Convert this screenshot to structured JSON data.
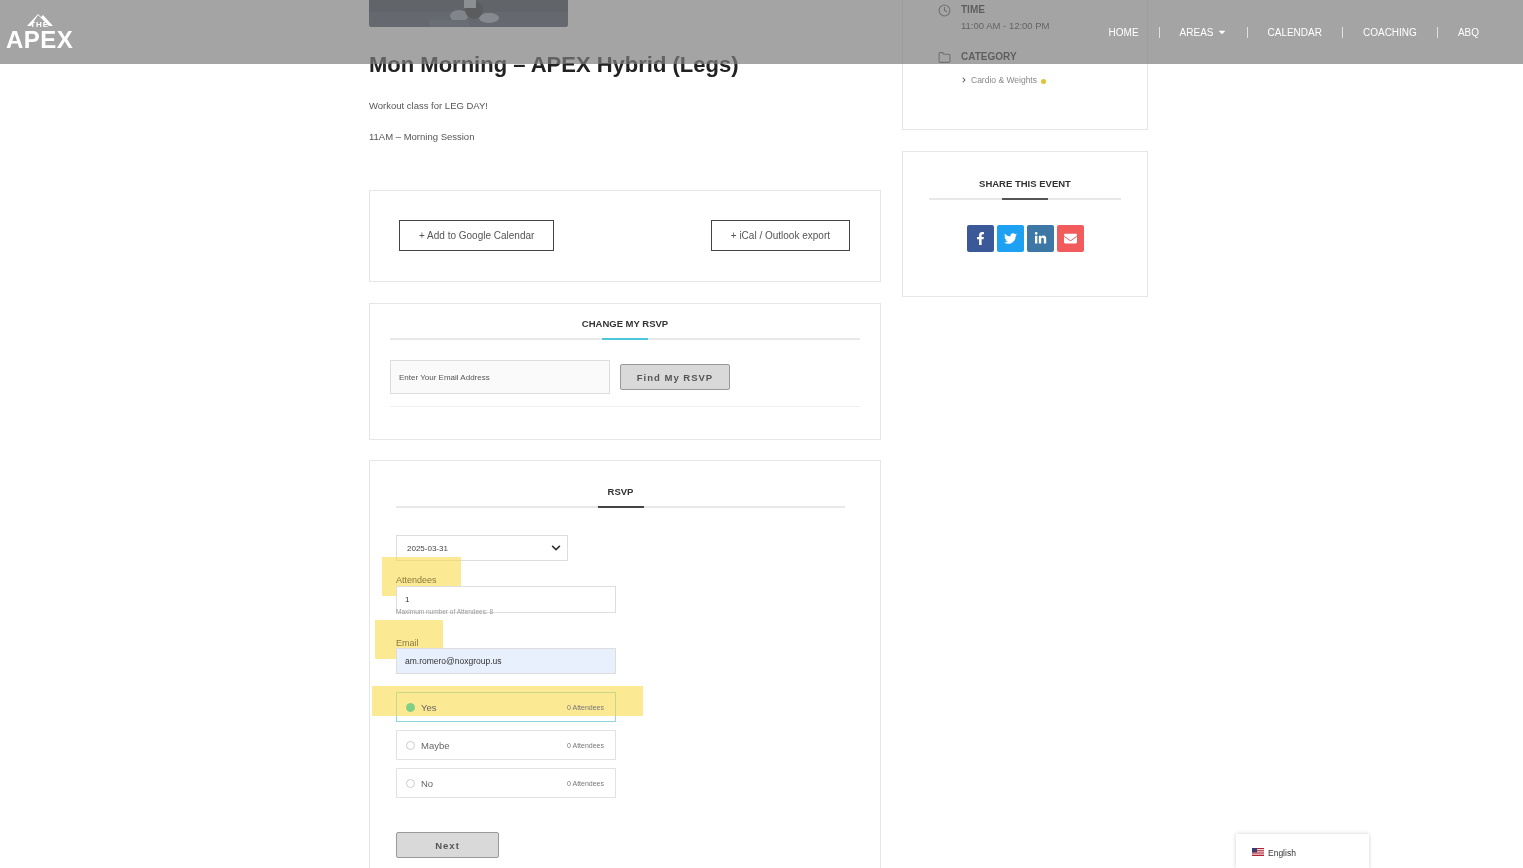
{
  "header": {
    "logo_top": "THE",
    "logo_main": "APEX",
    "nav": [
      {
        "label": "HOME",
        "dropdown": false
      },
      {
        "label": "AREAS",
        "dropdown": true
      },
      {
        "label": "CALENDAR",
        "dropdown": false
      },
      {
        "label": "COACHING",
        "dropdown": false
      },
      {
        "label": "ABQ",
        "dropdown": false
      }
    ]
  },
  "event": {
    "image": {
      "kind": "picture"
    },
    "title": "Mon Morning – APEX Hybrid (Legs)",
    "description": [
      "Workout class for LEG DAY!",
      "11AM – Morning Session"
    ]
  },
  "calendar_buttons": [
    "+ Add to Google Calendar",
    "+ iCal / Outlook export"
  ],
  "change_rsvp": {
    "title": "CHANGE MY RSVP",
    "email_placeholder": "Enter Your Email Address",
    "button": "Find My RSVP"
  },
  "rsvp": {
    "title": "RSVP",
    "date": "2025-03-31",
    "attendees_label": {
      "text": "Attendees",
      "highlighted": true
    },
    "attendees_value": "1",
    "attendees_hint": "Maximum number of Attendees: 8",
    "email_label": {
      "text": "Email",
      "highlighted": true
    },
    "email_value": "am.romero@noxgroup.us",
    "options": [
      {
        "label": "Yes",
        "count": "0 Attendees",
        "selected": true,
        "highlighted": true
      },
      {
        "label": "Maybe",
        "count": "0 Attendees",
        "selected": false,
        "highlighted": false
      },
      {
        "label": "No",
        "count": "0 Attendees",
        "selected": false,
        "highlighted": false
      }
    ],
    "button": "Next"
  },
  "details": {
    "time_label": "TIME",
    "time_value": "11:00 AM - 12:00 PM",
    "category_label": "CATEGORY",
    "categories": [
      {
        "name": "Cardio & Weights",
        "color": "#e0c234"
      }
    ]
  },
  "share": {
    "title": "SHARE THIS EVENT",
    "buttons": [
      {
        "kind": "facebook"
      },
      {
        "kind": "twitter"
      },
      {
        "kind": "linkedin"
      },
      {
        "kind": "email"
      }
    ]
  },
  "language": {
    "label": "English"
  }
}
